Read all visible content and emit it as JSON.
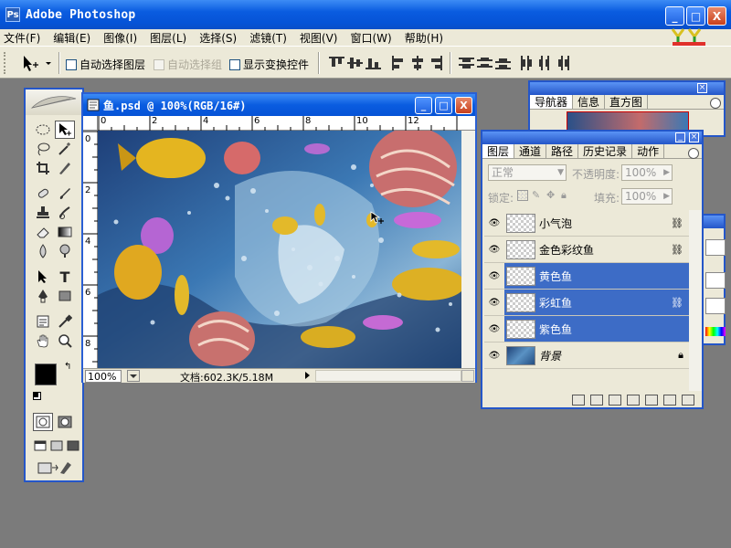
{
  "window": {
    "title": "Adobe Photoshop",
    "icon_label": "Ps"
  },
  "window_controls": {
    "minimize": "_",
    "maximize": "□",
    "close": "X"
  },
  "menu": [
    "文件(F)",
    "编辑(E)",
    "图像(I)",
    "图层(L)",
    "选择(S)",
    "滤镜(T)",
    "视图(V)",
    "窗口(W)",
    "帮助(H)"
  ],
  "options": {
    "auto_select_layer": "自动选择图层",
    "auto_select_group": "自动选择组",
    "show_transform_controls": "显示变换控件"
  },
  "document": {
    "title": "鱼.psd @ 100%(RGB/16#)",
    "zoom": "100%",
    "doc_info": "文档:602.3K/5.18M",
    "ruler_top": [
      "0",
      "2",
      "4",
      "6",
      "8",
      "10",
      "12"
    ],
    "ruler_left": [
      "0",
      "2",
      "4",
      "6",
      "8"
    ]
  },
  "navigator": {
    "tabs": [
      "导航器",
      "信息",
      "直方图"
    ]
  },
  "layers_panel": {
    "tabs": [
      "图层",
      "通道",
      "路径",
      "历史记录",
      "动作"
    ],
    "blend_mode": "正常",
    "opacity_label": "不透明度:",
    "opacity_value": "100%",
    "lock_label": "锁定:",
    "fill_label": "填充:",
    "fill_value": "100%",
    "layers": [
      {
        "name": "小气泡",
        "selected": false,
        "linked": true
      },
      {
        "name": "金色彩纹鱼",
        "selected": false,
        "linked": true
      },
      {
        "name": "黄色鱼",
        "selected": true,
        "linked": false
      },
      {
        "name": "彩虹鱼",
        "selected": true,
        "linked": true
      },
      {
        "name": "紫色鱼",
        "selected": true,
        "linked": false
      },
      {
        "name": "背景",
        "selected": false,
        "locked": true
      }
    ]
  },
  "colors": {
    "titlebar": "#0a5ce0",
    "selection": "#3d6cc6",
    "panel_bg": "#ece9d8",
    "workspace": "#7b7b7b"
  }
}
